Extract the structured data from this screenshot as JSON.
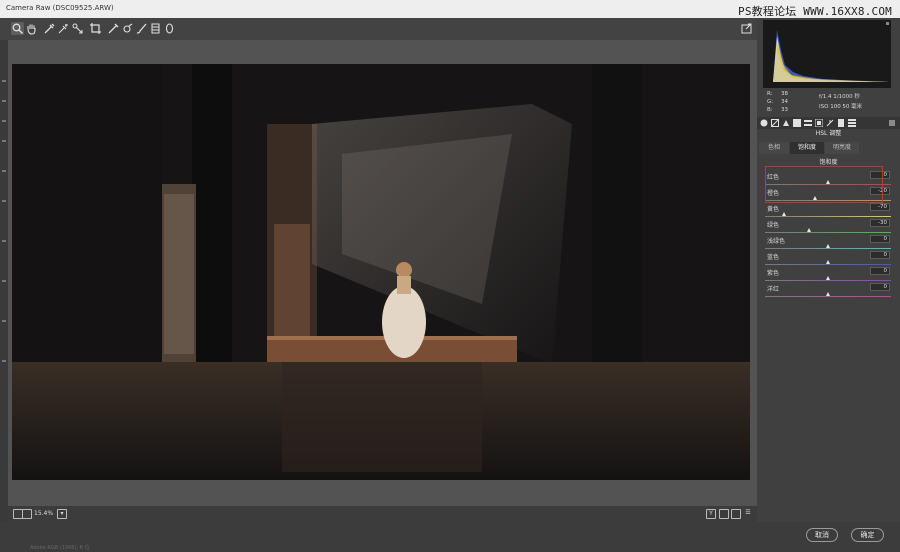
{
  "window": {
    "title": "Camera Raw (DSC09525.ARW)",
    "watermark": "PS教程论坛 WWW.16XX8.COM"
  },
  "toolbar": {
    "tools": [
      {
        "name": "zoom-tool-icon",
        "active": true
      },
      {
        "name": "hand-tool-icon"
      },
      {
        "name": "white-balance-icon"
      },
      {
        "name": "color-sampler-icon"
      },
      {
        "name": "targeted-adjustment-icon"
      },
      {
        "name": "crop-icon"
      },
      {
        "name": "straighten-icon"
      },
      {
        "name": "spot-removal-icon"
      },
      {
        "name": "adjustment-brush-icon"
      },
      {
        "name": "graduated-filter-icon"
      },
      {
        "name": "radial-filter-icon"
      }
    ]
  },
  "status": {
    "zoom": "15.4%",
    "bottom_info": "Adobe RGB (1998); 8 位"
  },
  "buttons": {
    "cancel": "取消",
    "done": "确定"
  },
  "meta": {
    "r_label": "R:",
    "r_value": "38",
    "g_label": "G:",
    "g_value": "34",
    "b_label": "B:",
    "b_value": "33",
    "cam_line1": "f/1.4   1/1000 秒",
    "cam_line2": "ISO 100   50 毫米"
  },
  "panel": {
    "title": "HSL 调整",
    "tabs": [
      "色相",
      "饱和度",
      "明亮度"
    ],
    "active_tab": 1,
    "section": "饱和度",
    "sliders": [
      {
        "label": "红色",
        "value": "0",
        "position": 0.5,
        "gradient": "linear-gradient(to right,#7a7a7a,#d23a3a)"
      },
      {
        "label": "橙色",
        "value": "-20",
        "position": 0.4,
        "gradient": "linear-gradient(to right,#7a7a7a,#e08a2a)"
      },
      {
        "label": "黄色",
        "value": "-70",
        "position": 0.15,
        "gradient": "linear-gradient(to right,#7a7a7a,#e3d33a)"
      },
      {
        "label": "绿色",
        "value": "-30",
        "position": 0.35,
        "gradient": "linear-gradient(to right,#7a7a7a,#3cc43c)"
      },
      {
        "label": "浅绿色",
        "value": "0",
        "position": 0.5,
        "gradient": "linear-gradient(to right,#7a7a7a,#3fc6c0)"
      },
      {
        "label": "蓝色",
        "value": "0",
        "position": 0.5,
        "gradient": "linear-gradient(to right,#7a7a7a,#3a5ad6)"
      },
      {
        "label": "紫色",
        "value": "0",
        "position": 0.5,
        "gradient": "linear-gradient(to right,#7a7a7a,#9a3ad6)"
      },
      {
        "label": "洋红",
        "value": "0",
        "position": 0.5,
        "gradient": "linear-gradient(to right,#7a7a7a,#d43aa8)"
      }
    ]
  },
  "colors": {
    "highlight_box": "#b53b3b"
  }
}
